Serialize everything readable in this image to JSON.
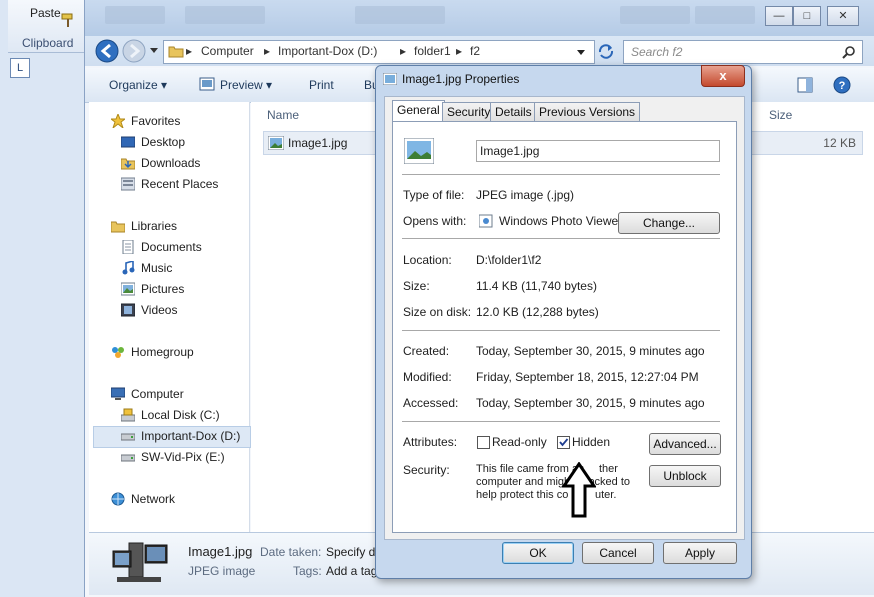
{
  "ribbon": {
    "paste_label": "Paste",
    "clipboard_label": "Clipboard"
  },
  "explorer": {
    "window_buttons": [
      "—",
      "□",
      "✕"
    ],
    "breadcrumb": [
      "Computer",
      "Important-Dox (D:)",
      "folder1",
      "f2"
    ],
    "search_placeholder": "Search f2",
    "toolbar": {
      "organize": "Organize",
      "preview": "Preview",
      "print": "Print",
      "burn": "Bu"
    },
    "nav": {
      "favorites": "Favorites",
      "desktop": "Desktop",
      "downloads": "Downloads",
      "recent_places": "Recent Places",
      "libraries": "Libraries",
      "documents": "Documents",
      "music": "Music",
      "pictures": "Pictures",
      "videos": "Videos",
      "homegroup": "Homegroup",
      "computer": "Computer",
      "local_disk": "Local Disk (C:)",
      "important_dox": "Important-Dox (D:)",
      "sw_vid_pix": "SW-Vid-Pix (E:)",
      "network": "Network"
    },
    "columns": {
      "name": "Name",
      "size": "Size"
    },
    "files": [
      {
        "name": "Image1.jpg",
        "size": "12 KB"
      }
    ],
    "details": {
      "file_name": "Image1.jpg",
      "file_type": "JPEG image",
      "date_taken_label": "Date taken:",
      "date_taken_value": "Specify da",
      "tags_label": "Tags:",
      "tags_value": "Add a tag"
    }
  },
  "dialog": {
    "title": "Image1.jpg Properties",
    "close_label": "x",
    "tabs": [
      "General",
      "Security",
      "Details",
      "Previous Versions"
    ],
    "file_name": "Image1.jpg",
    "type_of_file_label": "Type of file:",
    "type_of_file_value": "JPEG image (.jpg)",
    "opens_with_label": "Opens with:",
    "opens_with_value": "Windows Photo Viewer",
    "change_button": "Change...",
    "location_label": "Location:",
    "location_value": "D:\\folder1\\f2",
    "size_label": "Size:",
    "size_value": "11.4 KB (11,740 bytes)",
    "size_on_disk_label": "Size on disk:",
    "size_on_disk_value": "12.0 KB (12,288 bytes)",
    "created_label": "Created:",
    "created_value": "Today, September 30, 2015, 9 minutes ago",
    "modified_label": "Modified:",
    "modified_value": "Friday, September 18, 2015, 12:27:04 PM",
    "accessed_label": "Accessed:",
    "accessed_value": "Today, September 30, 2015, 9 minutes ago",
    "attributes_label": "Attributes:",
    "readonly_label": "Read-only",
    "readonly_checked": false,
    "hidden_label": "Hidden",
    "hidden_checked": true,
    "advanced_button": "Advanced...",
    "security_label": "Security:",
    "security_line1": "This file came from an",
    "security_line1b": "ther",
    "security_line2": "computer and might",
    "security_line2b": "locked to",
    "security_line3": "help protect this co",
    "security_line3b": "uter.",
    "unblock_button": "Unblock",
    "ok_button": "OK",
    "cancel_button": "Cancel",
    "apply_button": "Apply"
  }
}
